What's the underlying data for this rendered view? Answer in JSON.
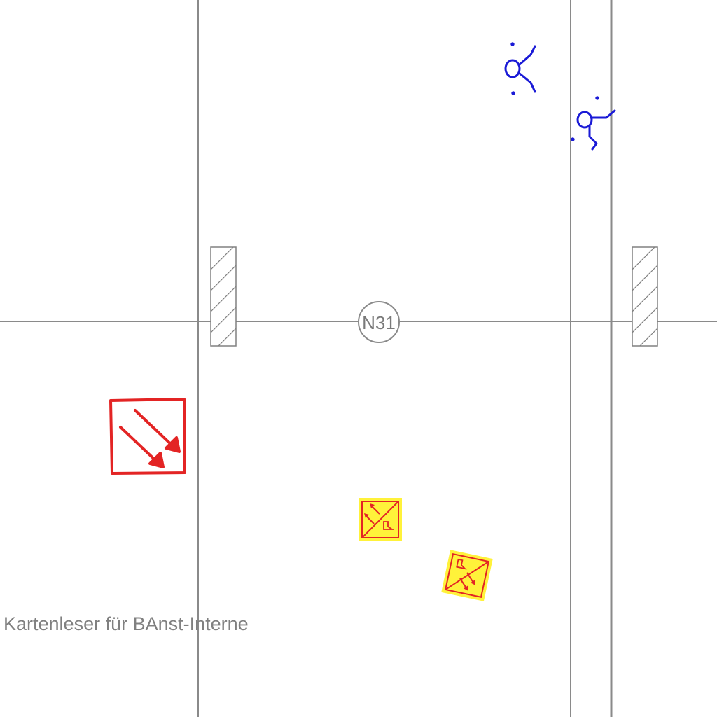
{
  "drawing": {
    "grid_label": "N31",
    "caption": "Kartenleser für BAnst-Interne",
    "colors": {
      "grid_line": "#8a8a8a",
      "hatch": "#808080",
      "door_symbol": "#e32424",
      "device_fill": "#fff23a",
      "device_stroke": "#e32424",
      "person_symbol": "#1a1ad6"
    },
    "symbols": [
      {
        "name": "escape-direction-icon",
        "meaning": "diagonal arrows sign"
      },
      {
        "name": "card-reader-icon",
        "meaning": "yellow device sign"
      },
      {
        "name": "person-icon",
        "meaning": "blue figure"
      }
    ]
  }
}
